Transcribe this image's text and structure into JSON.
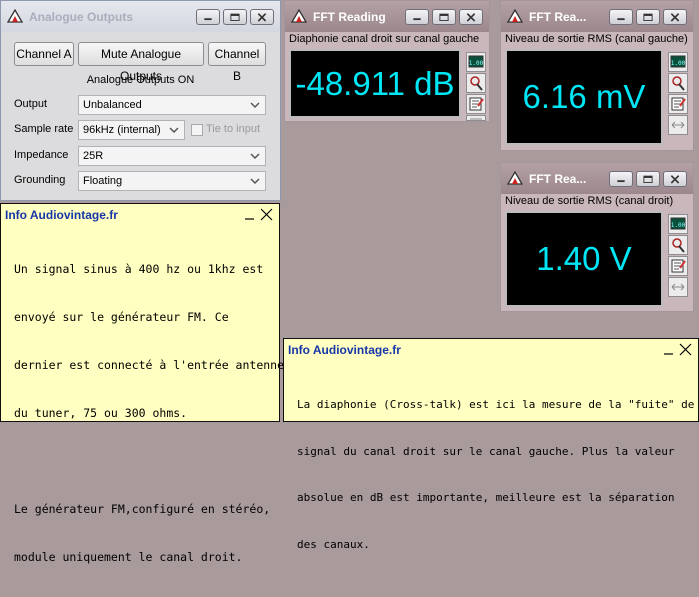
{
  "analogue_window": {
    "title": "Analogue Outputs",
    "buttons": {
      "channel_a": "Channel A",
      "mute": "Mute Analogue Outputs",
      "channel_b": "Channel B"
    },
    "status": "Analogue Outputs ON",
    "fields": [
      {
        "label": "Output",
        "value": "Unbalanced"
      },
      {
        "label": "Sample rate",
        "value": "96kHz (internal)",
        "checkbox_label": "Tie to input"
      },
      {
        "label": "Impedance",
        "value": "25R"
      },
      {
        "label": "Grounding",
        "value": "Floating"
      }
    ]
  },
  "fft_windows": [
    {
      "title": "FFT Reading",
      "label": "Diaphonie canal droit sur canal gauche",
      "value": "-48.911 dB"
    },
    {
      "title": "FFT Rea...",
      "label": "Niveau de sortie RMS (canal gauche)",
      "value": "6.16 mV"
    },
    {
      "title": "FFT Rea...",
      "label": "Niveau de sortie RMS (canal droit)",
      "value": "1.40 V"
    }
  ],
  "info_windows": [
    {
      "title": "Info Audiovintage.fr",
      "lines": [
        "Un signal sinus à 400 hz ou 1khz est",
        "envoyé sur le générateur FM. Ce",
        "dernier est connecté à l'entrée antenne",
        "du tuner, 75 ou 300 ohms.",
        "",
        "Le générateur FM,configuré en stéréo,",
        "module uniquement le canal droit."
      ]
    },
    {
      "title": "Info Audiovintage.fr",
      "lines": [
        "La diaphonie (Cross-talk) est ici la mesure de la \"fuite\" de",
        "signal du canal droit sur le canal gauche. Plus la valeur",
        "absolue en dB est importante, meilleure est la séparation",
        "des canaux."
      ]
    }
  ],
  "icons": [
    "app-logo-icon",
    "minimize-icon",
    "maximize-icon",
    "close-icon",
    "chevron-down-icon",
    "readout-icon",
    "probe-icon",
    "notepad-icon",
    "resize-arrows-icon"
  ],
  "colors": {
    "readout_text": "#00e6f5",
    "display_bg": "#000000",
    "info_bg": "#ffffc1",
    "info_title": "#1737a8"
  }
}
